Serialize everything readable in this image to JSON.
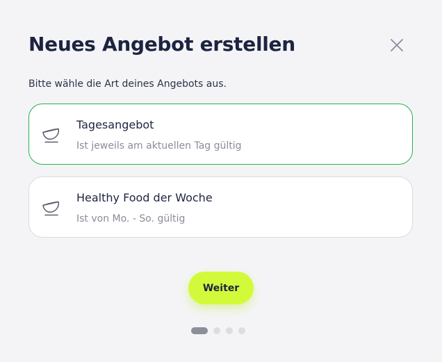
{
  "dialog": {
    "title": "Neues Angebot erstellen",
    "subtitle": "Bitte wähle die Art deines Angebots aus.",
    "close_icon": "close-icon"
  },
  "options": [
    {
      "label": "Tagesangebot",
      "description": "Ist jeweils am aktuellen Tag gültig",
      "icon": "bowl-icon",
      "selected": true
    },
    {
      "label": "Healthy Food der Woche",
      "description": "Ist von Mo. - So. gültig",
      "icon": "bowl-icon",
      "selected": false
    }
  ],
  "actions": {
    "next_label": "Weiter"
  },
  "pagination": {
    "current_step": 1,
    "total_steps": 4
  },
  "colors": {
    "accent": "#d2fa3a",
    "selected_border": "#22b24c",
    "title_text": "#1d2440"
  }
}
